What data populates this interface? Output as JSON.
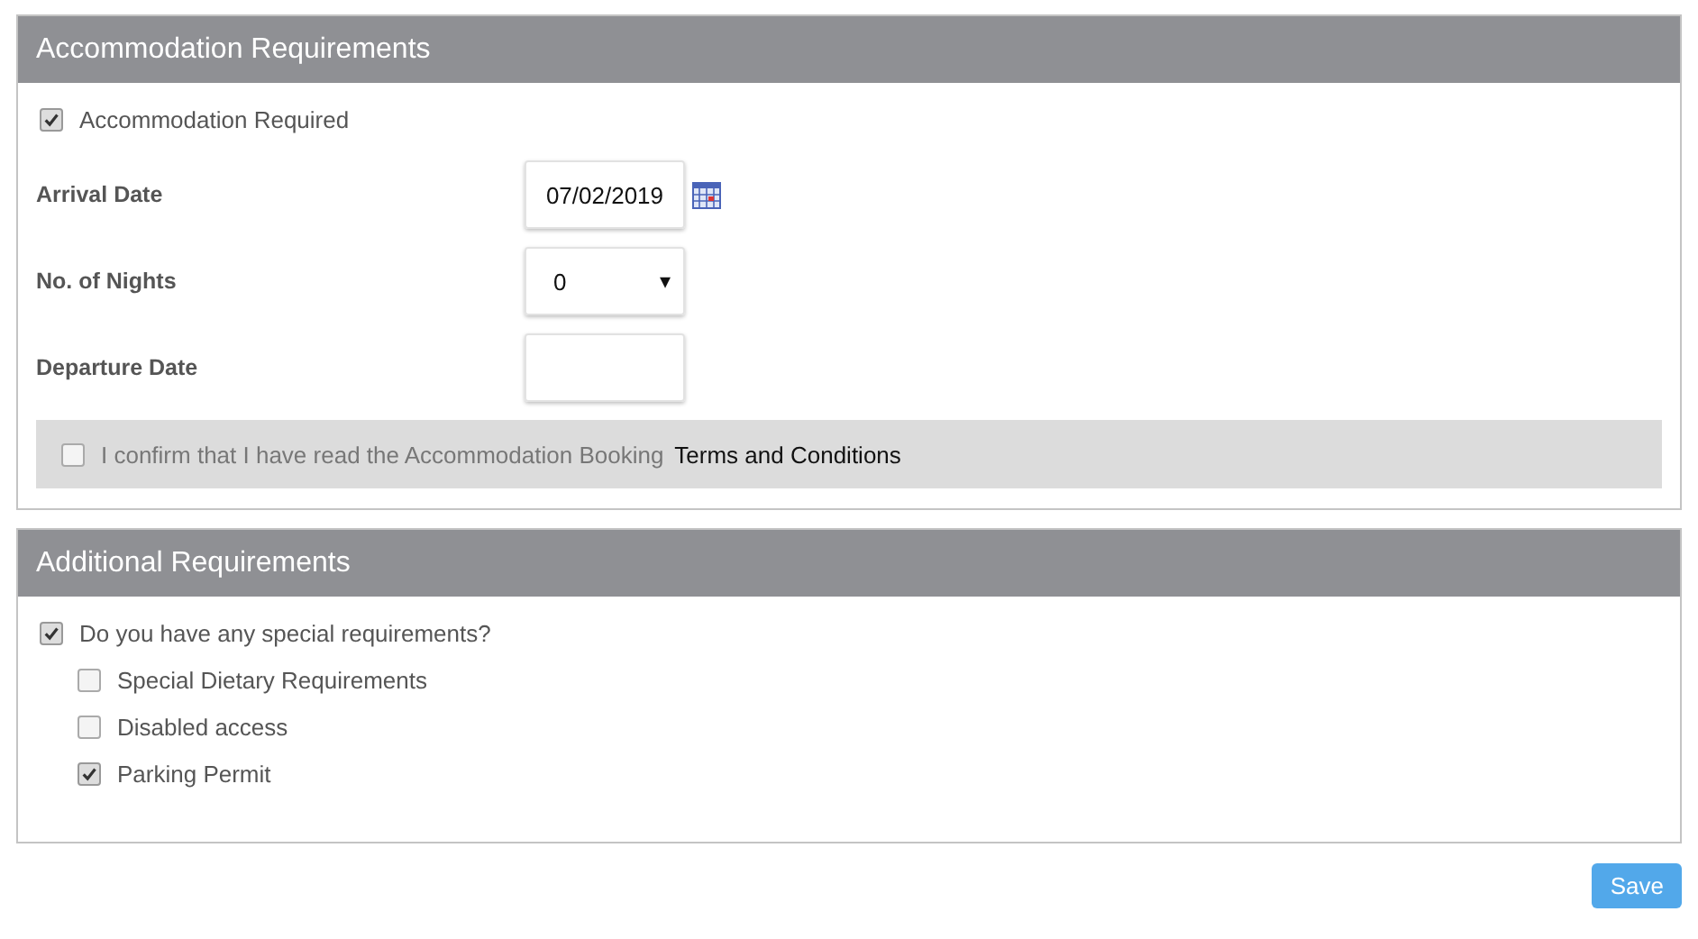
{
  "accommodation": {
    "title": "Accommodation Requirements",
    "required": {
      "label": "Accommodation Required",
      "checked": true
    },
    "fields": [
      {
        "kind": "date",
        "label": "Arrival Date",
        "value": "07/02/2019"
      },
      {
        "kind": "select",
        "label": "No. of Nights",
        "value": "0",
        "caret": "▾"
      },
      {
        "kind": "text",
        "label": "Departure Date"
      }
    ],
    "confirm": {
      "text": "I confirm that I have read the Accommodation Booking",
      "link": "Terms and Conditions",
      "checked": false
    }
  },
  "additional": {
    "title": "Additional Requirements",
    "question": {
      "label": "Do you have any special requirements?",
      "checked": true
    },
    "options": [
      {
        "label": "Special Dietary Requirements",
        "checked": false
      },
      {
        "label": "Disabled access",
        "checked": false
      },
      {
        "label": "Parking Permit",
        "checked": true
      }
    ]
  },
  "save_button": "Save"
}
